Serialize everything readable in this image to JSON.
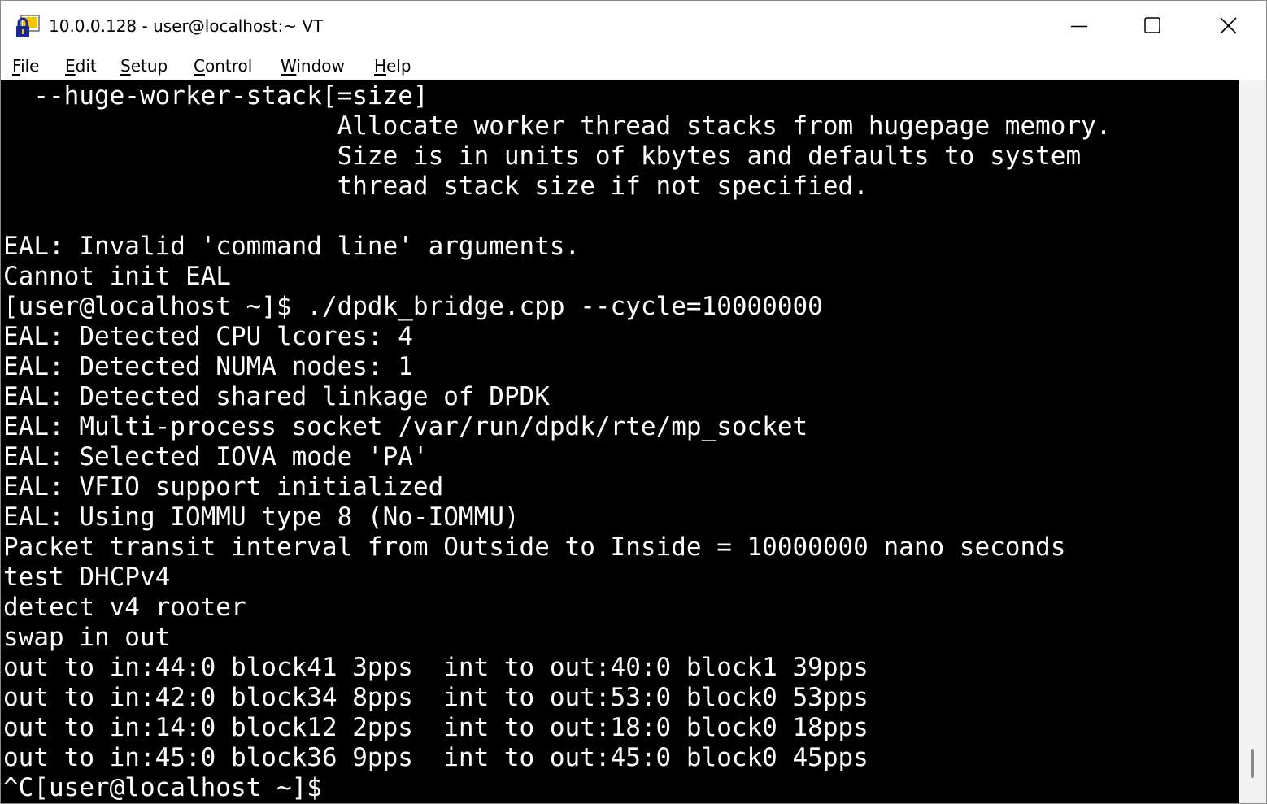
{
  "window": {
    "title": "10.0.0.128 - user@localhost:~ VT"
  },
  "menubar": {
    "items": [
      {
        "label": "File",
        "accel": "F",
        "rest": "ile"
      },
      {
        "label": "Edit",
        "accel": "E",
        "rest": "dit"
      },
      {
        "label": "Setup",
        "accel": "S",
        "rest": "etup"
      },
      {
        "label": "Control",
        "accel": "C",
        "rest": "ontrol"
      },
      {
        "label": "Window",
        "accel": "W",
        "rest": "indow"
      },
      {
        "label": "Help",
        "accel": "H",
        "rest": "elp"
      }
    ]
  },
  "icons": {
    "app": "teraterm-lock-icon",
    "minimize": "minimize-icon",
    "maximize": "maximize-icon",
    "close": "close-icon"
  },
  "colors": {
    "terminal_bg": "#000000",
    "terminal_fg": "#ffffff"
  },
  "terminal": {
    "lines": [
      "  --huge-worker-stack[=size]",
      "                      Allocate worker thread stacks from hugepage memory.",
      "                      Size is in units of kbytes and defaults to system",
      "                      thread stack size if not specified.",
      "",
      "EAL: Invalid 'command line' arguments.",
      "Cannot init EAL",
      "[user@localhost ~]$ ./dpdk_bridge.cpp --cycle=10000000",
      "EAL: Detected CPU lcores: 4",
      "EAL: Detected NUMA nodes: 1",
      "EAL: Detected shared linkage of DPDK",
      "EAL: Multi-process socket /var/run/dpdk/rte/mp_socket",
      "EAL: Selected IOVA mode 'PA'",
      "EAL: VFIO support initialized",
      "EAL: Using IOMMU type 8 (No-IOMMU)",
      "Packet transit interval from Outside to Inside = 10000000 nano seconds",
      "test DHCPv4",
      "detect v4 rooter",
      "swap in out",
      "out to in:44:0 block41 3pps  int to out:40:0 block1 39pps",
      "out to in:42:0 block34 8pps  int to out:53:0 block0 53pps",
      "out to in:14:0 block12 2pps  int to out:18:0 block0 18pps",
      "out to in:45:0 block36 9pps  int to out:45:0 block0 45pps",
      "^C[user@localhost ~]$ "
    ]
  }
}
